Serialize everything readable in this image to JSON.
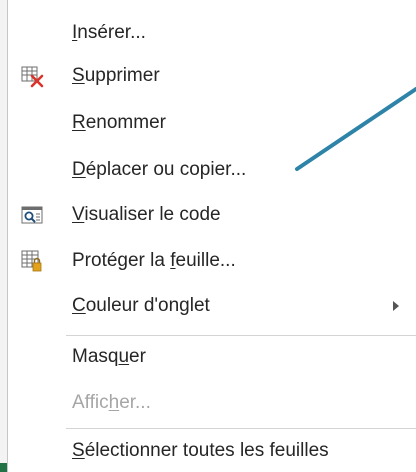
{
  "menu": {
    "items": [
      {
        "label": "Insérer...",
        "underline_char": "I",
        "icon": "none",
        "disabled": false
      },
      {
        "label": "Supprimer",
        "underline_char": "S",
        "icon": "delete-sheet-icon",
        "disabled": false
      },
      {
        "label": "Renommer",
        "underline_char": "R",
        "icon": "none",
        "disabled": false
      },
      {
        "label": "Déplacer ou copier...",
        "underline_char": "D",
        "icon": "none",
        "disabled": false
      },
      {
        "label": "Visualiser le code",
        "underline_char": "V",
        "icon": "view-code-icon",
        "disabled": false
      },
      {
        "label": "Protéger la feuille...",
        "underline_char": "f",
        "icon": "protect-sheet-icon",
        "disabled": false
      },
      {
        "label": "Couleur d'onglet",
        "underline_char": "C",
        "icon": "none",
        "disabled": false,
        "submenu": true
      },
      {
        "label": "Masquer",
        "underline_char": "u",
        "icon": "none",
        "disabled": false
      },
      {
        "label": "Afficher...",
        "underline_char": "h",
        "icon": "none",
        "disabled": true
      },
      {
        "label": "Sélectionner toutes les feuilles",
        "underline_char": "S",
        "icon": "none",
        "disabled": false
      }
    ]
  },
  "colors": {
    "text": "#262626",
    "disabled_text": "#a6a6a6",
    "annotation_line": "#2e84a8",
    "delete_red": "#d9342b",
    "lock_gold": "#e3a21a"
  }
}
